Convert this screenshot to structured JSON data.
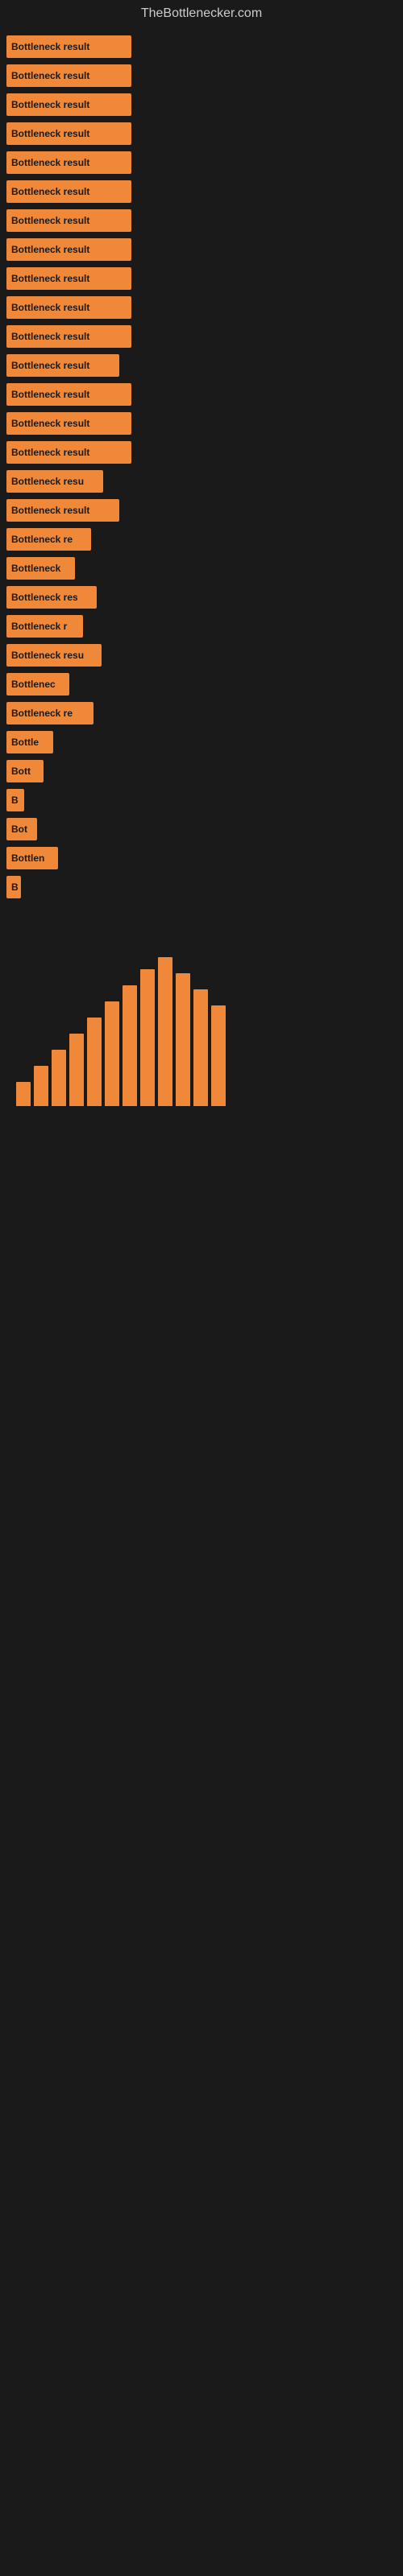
{
  "site": {
    "title": "TheBottlenecker.com"
  },
  "bars": [
    {
      "label": "Bottleneck result",
      "width": 155,
      "visible_text": "Bottleneck result"
    },
    {
      "label": "Bottleneck result",
      "width": 155,
      "visible_text": "Bottleneck result"
    },
    {
      "label": "Bottleneck result",
      "width": 155,
      "visible_text": "Bottleneck result"
    },
    {
      "label": "Bottleneck result",
      "width": 155,
      "visible_text": "Bottleneck result"
    },
    {
      "label": "Bottleneck result",
      "width": 155,
      "visible_text": "Bottleneck result"
    },
    {
      "label": "Bottleneck result",
      "width": 155,
      "visible_text": "Bottleneck result"
    },
    {
      "label": "Bottleneck result",
      "width": 155,
      "visible_text": "Bottleneck result"
    },
    {
      "label": "Bottleneck result",
      "width": 155,
      "visible_text": "Bottleneck result"
    },
    {
      "label": "Bottleneck result",
      "width": 155,
      "visible_text": "Bottleneck result"
    },
    {
      "label": "Bottleneck result",
      "width": 155,
      "visible_text": "Bottleneck result"
    },
    {
      "label": "Bottleneck result",
      "width": 155,
      "visible_text": "Bottleneck result"
    },
    {
      "label": "Bottleneck result",
      "width": 140,
      "visible_text": "Bottleneck result"
    },
    {
      "label": "Bottleneck result",
      "width": 155,
      "visible_text": "Bottleneck result"
    },
    {
      "label": "Bottleneck result",
      "width": 155,
      "visible_text": "Bottleneck result"
    },
    {
      "label": "Bottleneck result",
      "width": 155,
      "visible_text": "Bottleneck result"
    },
    {
      "label": "Bottleneck resu",
      "width": 120,
      "visible_text": "Bottleneck resu"
    },
    {
      "label": "Bottleneck result",
      "width": 140,
      "visible_text": "Bottleneck result"
    },
    {
      "label": "Bottleneck re",
      "width": 105,
      "visible_text": "Bottleneck re"
    },
    {
      "label": "Bottleneck",
      "width": 85,
      "visible_text": "Bottleneck"
    },
    {
      "label": "Bottleneck res",
      "width": 112,
      "visible_text": "Bottleneck res"
    },
    {
      "label": "Bottleneck r",
      "width": 95,
      "visible_text": "Bottleneck r"
    },
    {
      "label": "Bottleneck resu",
      "width": 118,
      "visible_text": "Bottleneck resu"
    },
    {
      "label": "Bottlenec",
      "width": 78,
      "visible_text": "Bottlenec"
    },
    {
      "label": "Bottleneck re",
      "width": 108,
      "visible_text": "Bottleneck re"
    },
    {
      "label": "Bottle",
      "width": 58,
      "visible_text": "Bottle"
    },
    {
      "label": "Bott",
      "width": 46,
      "visible_text": "Bott"
    },
    {
      "label": "B",
      "width": 22,
      "visible_text": "B"
    },
    {
      "label": "Bot",
      "width": 38,
      "visible_text": "Bot"
    },
    {
      "label": "Bottlen",
      "width": 64,
      "visible_text": "Bottlen"
    },
    {
      "label": "B",
      "width": 18,
      "visible_text": "B"
    }
  ],
  "vertical_bars": [
    {
      "height": 30
    },
    {
      "height": 50
    },
    {
      "height": 70
    },
    {
      "height": 90
    },
    {
      "height": 110
    },
    {
      "height": 130
    },
    {
      "height": 150
    },
    {
      "height": 170
    },
    {
      "height": 185
    },
    {
      "height": 165
    },
    {
      "height": 145
    },
    {
      "height": 125
    }
  ]
}
